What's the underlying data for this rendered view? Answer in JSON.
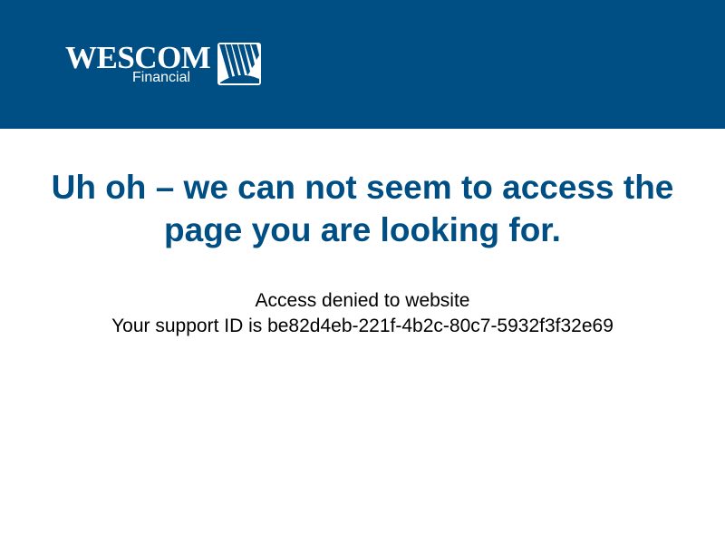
{
  "brand": {
    "name": "WESCOM",
    "sub": "Financial",
    "logo_icon": "wescom-wave-mark-icon",
    "primary_color": "#004f84"
  },
  "main": {
    "heading_line1": "Uh oh – we can not seem to access the",
    "heading_line2": "page you are looking for.",
    "message_line1": "Access denied to website",
    "message_prefix": "Your support ID is ",
    "support_id": "be82d4eb-221f-4b2c-80c7-5932f3f32e69"
  }
}
